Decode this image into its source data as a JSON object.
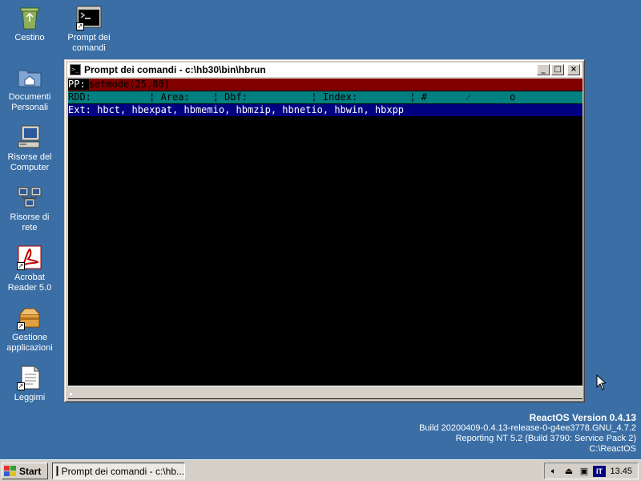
{
  "desktop": {
    "icons": [
      {
        "name": "recycle-bin-icon",
        "label": "Cestino"
      },
      {
        "name": "command-prompt-icon",
        "label": "Prompt dei\ncomandi"
      },
      {
        "name": "my-documents-icon",
        "label": "Documenti\nPersonali"
      },
      {
        "name": "my-computer-icon",
        "label": "Risorse del\nComputer"
      },
      {
        "name": "network-places-icon",
        "label": "Risorse di\nrete"
      },
      {
        "name": "acrobat-reader-icon",
        "label": "Acrobat\nReader 5.0"
      },
      {
        "name": "app-manager-icon",
        "label": "Gestione\napplicazioni"
      },
      {
        "name": "readme-icon",
        "label": "Leggimi"
      }
    ]
  },
  "window": {
    "title": "Prompt dei comandi - c:\\hb30\\bin\\hbrun",
    "buttons": {
      "minimize": "_",
      "maximize": "□",
      "close": "×"
    },
    "console": {
      "pp_label": "PP:",
      "pp_command": "setmode(25,80)",
      "status_line": "RDD:          ¦ Area:    ¦ Dbf:           ¦ Index:         ¦ #       ⁄       o",
      "ext_line": "Ext: hbct, hbexpat, hbmemio, hbmzip, hbnetio, hbwin, hbxpp"
    }
  },
  "watermark": {
    "title": "ReactOS Version 0.4.13",
    "build": "Build 20200409-0.4.13-release-0-g4ee3778.GNU_4.7.2",
    "reporting": "Reporting NT 5.2 (Build 3790: Service Pack 2)",
    "path": "C:\\ReactOS"
  },
  "taskbar": {
    "start_label": "Start",
    "task_label": "Prompt dei comandi - c:\\hb...",
    "tray": {
      "language": "IT",
      "clock": "13.45"
    }
  },
  "colors": {
    "desktop_bg": "#3a6ea5",
    "console_pp_bg": "#800000",
    "console_status_bg": "#008080",
    "console_ext_bg": "#000080"
  }
}
